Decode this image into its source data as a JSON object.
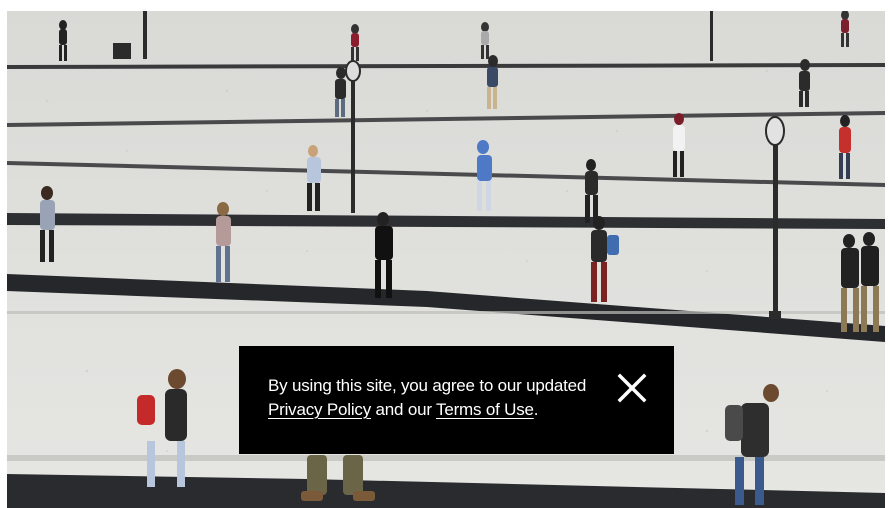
{
  "photo": {
    "icon": "campus-photo",
    "description_hidden": true
  },
  "notice": {
    "text_before": "By using this site, you agree to our updated ",
    "privacy_link": "Privacy Policy",
    "text_middle": " and our ",
    "terms_link": "Terms of Use",
    "text_after": ".",
    "close_icon": "close-icon",
    "background": "#000000",
    "text_color": "#ffffff"
  }
}
